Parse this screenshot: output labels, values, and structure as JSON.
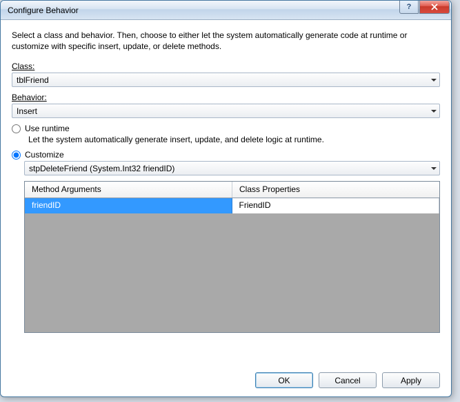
{
  "titlebar": {
    "title": "Configure Behavior",
    "help_symbol": "?",
    "close_symbol": "×"
  },
  "instructions": "Select a class and behavior.  Then, choose to either let the system automatically generate code at runtime or customize with specific insert, update, or delete methods.",
  "class_section": {
    "label": "Class:",
    "value": "tblFriend"
  },
  "behavior_section": {
    "label": "Behavior:",
    "value": "Insert"
  },
  "runtime_option": {
    "label": "Use runtime",
    "description": "Let the system automatically generate insert, update, and delete logic at runtime."
  },
  "customize_option": {
    "label": "Customize",
    "procedure": "stpDeleteFriend (System.Int32 friendID)"
  },
  "grid": {
    "columns": [
      "Method Arguments",
      "Class Properties"
    ],
    "rows": [
      {
        "arg": "friendID",
        "prop": "FriendID"
      }
    ]
  },
  "buttons": {
    "ok": "OK",
    "cancel": "Cancel",
    "apply": "Apply"
  }
}
